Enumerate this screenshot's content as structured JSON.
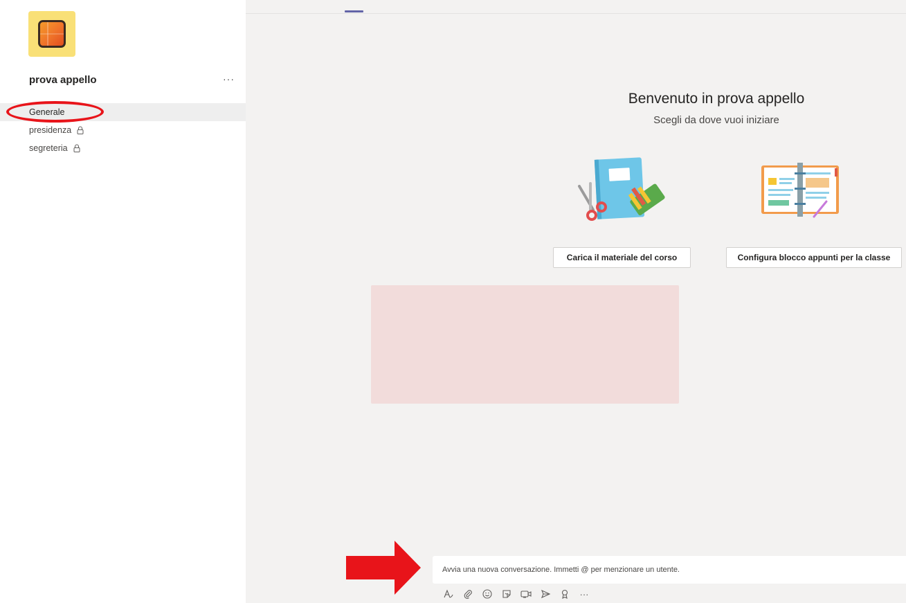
{
  "sidebar": {
    "team_name": "prova appello",
    "more_label": "···",
    "channels": [
      {
        "label": "Generale",
        "active": true,
        "locked": false
      },
      {
        "label": "presidenza",
        "active": false,
        "locked": true
      },
      {
        "label": "segreteria",
        "active": false,
        "locked": true
      }
    ]
  },
  "main": {
    "welcome_title": "Benvenuto in prova appello",
    "welcome_subtitle": "Scegli da dove vuoi iniziare",
    "button_upload": "Carica il materiale del corso",
    "button_notebook": "Configura blocco appunti per la classe"
  },
  "compose": {
    "placeholder": "Avvia una nuova conversazione. Immetti @ per menzionare un utente.",
    "more_label": "···"
  },
  "icons": {
    "toolbar": [
      "format-icon",
      "attach-icon",
      "emoji-icon",
      "sticker-icon",
      "meet-now-icon",
      "send-icon",
      "praise-icon",
      "more-options-icon"
    ]
  },
  "colors": {
    "accent": "#6264a7",
    "annotation_red": "#e8141a",
    "avatar_bg": "#f9e077",
    "highlight_box": "#f2dcdb"
  }
}
